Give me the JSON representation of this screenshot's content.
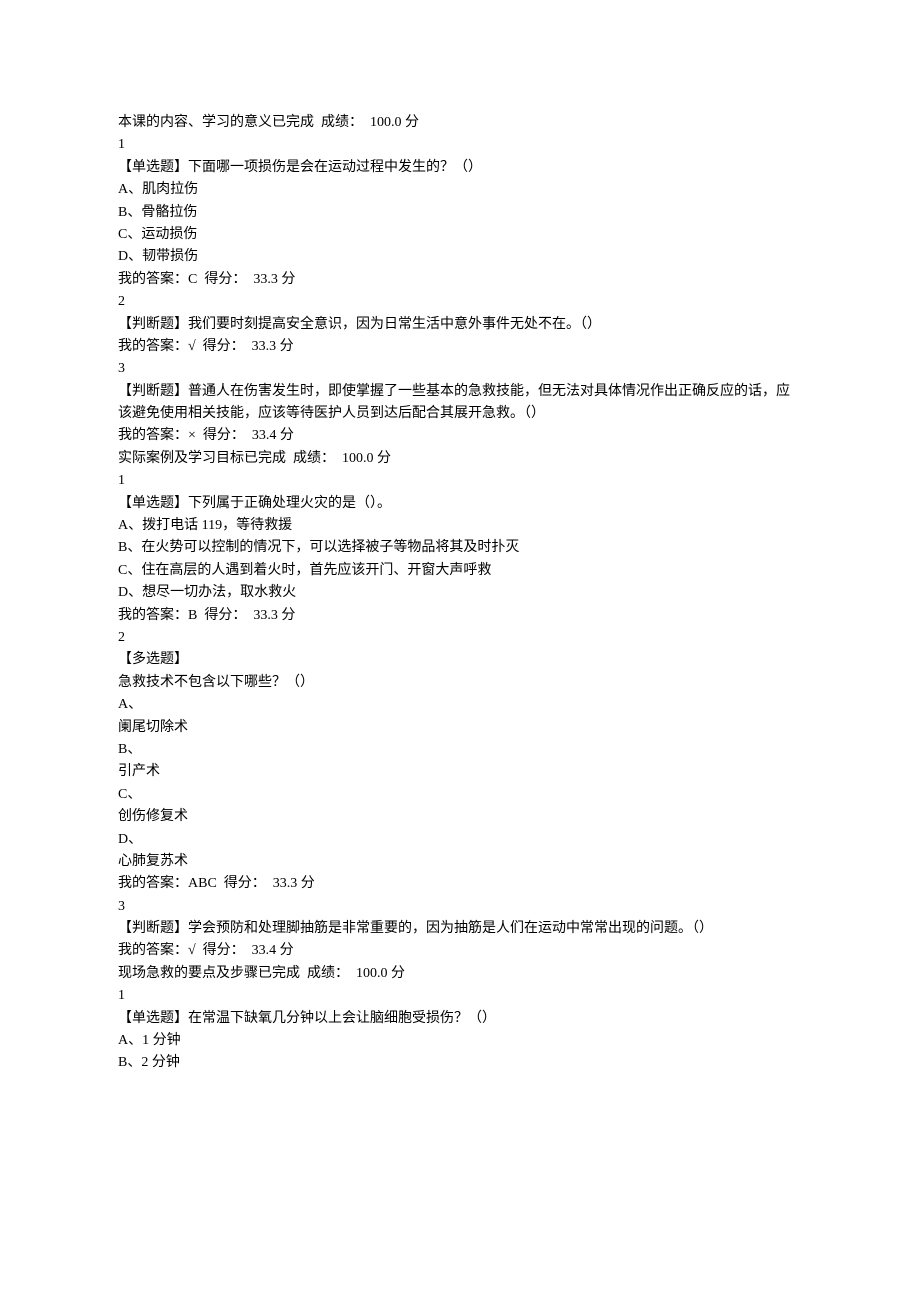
{
  "sections": [
    {
      "header": "本课的内容、学习的意义已完成  成绩：  100.0 分",
      "questions": [
        {
          "num": "1",
          "prompt": "【单选题】下面哪一项损伤是会在运动过程中发生的？（）",
          "options": [
            "A、肌肉拉伤",
            "B、骨骼拉伤",
            "C、运动损伤",
            "D、韧带损伤"
          ],
          "answer": "我的答案：C  得分：  33.3 分"
        },
        {
          "num": "2",
          "prompt": "【判断题】我们要时刻提高安全意识，因为日常生活中意外事件无处不在。（）",
          "options": [],
          "answer": "我的答案：√  得分：  33.3 分"
        },
        {
          "num": "3",
          "prompt": "【判断题】普通人在伤害发生时，即使掌握了一些基本的急救技能，但无法对具体情况作出正确反应的话，应该避免使用相关技能，应该等待医护人员到达后配合其展开急救。（）",
          "options": [],
          "answer": "我的答案：×  得分：  33.4 分"
        }
      ]
    },
    {
      "header": "实际案例及学习目标已完成  成绩：  100.0 分",
      "questions": [
        {
          "num": "1",
          "prompt": "【单选题】下列属于正确处理火灾的是（）。",
          "options": [
            "A、拨打电话 119，等待救援",
            "B、在火势可以控制的情况下，可以选择被子等物品将其及时扑灭",
            "C、住在高层的人遇到着火时，首先应该开门、开窗大声呼救",
            "D、想尽一切办法，取水救火"
          ],
          "answer": "我的答案：B  得分：  33.3 分"
        },
        {
          "num": "2",
          "prompt_lines": [
            "【多选题】",
            "急救技术不包含以下哪些？（）"
          ],
          "options_multiline": [
            "A、",
            "阑尾切除术",
            "B、",
            "引产术",
            "C、",
            "创伤修复术",
            "D、",
            "心肺复苏术"
          ],
          "answer": "我的答案：ABC  得分：  33.3 分"
        },
        {
          "num": "3",
          "prompt": "【判断题】学会预防和处理脚抽筋是非常重要的，因为抽筋是人们在运动中常常出现的问题。（）",
          "options": [],
          "answer": "我的答案：√  得分：  33.4 分"
        }
      ]
    },
    {
      "header": "现场急救的要点及步骤已完成  成绩：  100.0 分",
      "questions": [
        {
          "num": "1",
          "prompt": "【单选题】在常温下缺氧几分钟以上会让脑细胞受损伤？（）",
          "options": [
            "A、1 分钟",
            "B、2 分钟"
          ],
          "answer": null
        }
      ]
    }
  ]
}
